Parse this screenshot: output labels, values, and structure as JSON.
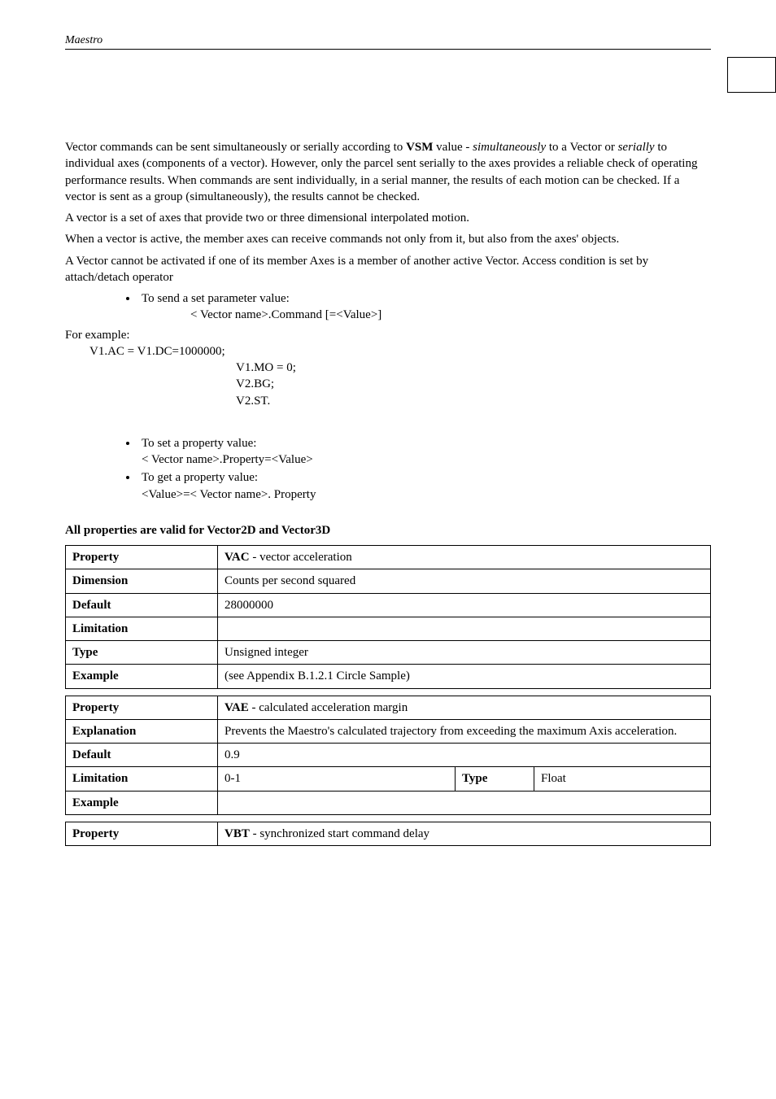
{
  "header": {
    "title": "Maestro"
  },
  "para": {
    "p1a": "Vector commands can be sent simultaneously or serially according to ",
    "p1b": "VSM",
    "p1c": " value - ",
    "p1d": "simultaneously",
    "p1e": " to a Vector or ",
    "p1f": "serially",
    "p1g": " to individual axes (components of a vector). However, only the parcel sent serially to the axes provides a reliable check of operating performance results. When commands are sent individually, in a serial manner, the results of each motion can be checked. If a vector is sent as a group (simultaneously), the results cannot be checked.",
    "p2": "A vector is a set of axes that provide two or three dimensional interpolated motion.",
    "p3": "When a vector is active, the member axes can receive commands not only from it, but also from the axes' objects.",
    "p4": "A Vector cannot be activated if one of its member Axes is a member of another active Vector. Access condition is set by attach/detach operator"
  },
  "bullets": {
    "send": "To send a set parameter value:",
    "send_line": "< Vector name>.Command [=<Value>]",
    "set": "To set a property value:",
    "set_line": "< Vector name>.Property=<Value>",
    "get": "To get a property value:",
    "get_line": "<Value>=< Vector name>. Property"
  },
  "example": {
    "label": "For example:",
    "l1": "V1.AC = V1.DC=1000000;",
    "l2": "V1.MO = 0;",
    "l3": "V2.BG;",
    "l4": "V2.ST."
  },
  "section_heading": "All properties are valid for Vector2D and Vector3D",
  "labels": {
    "Property": "Property",
    "Dimension": "Dimension",
    "Default": "Default",
    "Limitation": "Limitation",
    "Type": "Type",
    "Example": "Example",
    "Explanation": "Explanation"
  },
  "tables": {
    "vac": {
      "property_b": "VAC",
      "property_r": " - vector acceleration",
      "dimension": "Counts per second squared",
      "default": "28000000",
      "limitation": "",
      "type": "Unsigned integer",
      "example": "(see Appendix B.1.2.1 Circle Sample)"
    },
    "vae": {
      "property_b": "VAE",
      "property_r": " - calculated acceleration margin",
      "explanation": "Prevents the Maestro's calculated trajectory from exceeding the maximum Axis acceleration.",
      "default": "0.9",
      "limitation": "0-1",
      "type_val": "Float",
      "example": ""
    },
    "vbt": {
      "property_b": "VBT",
      "property_r": " - synchronized start command delay"
    }
  }
}
